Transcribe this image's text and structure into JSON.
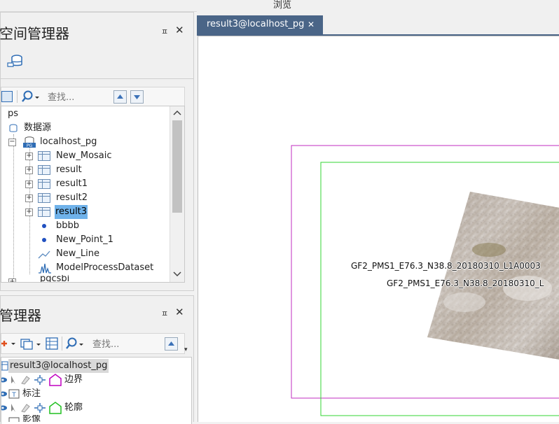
{
  "window": {
    "title": "浏览"
  },
  "workspace_panel": {
    "title": "空间管理器",
    "pin_glyph": "ㅍ",
    "close_glyph": "✕",
    "search_placeholder": "查找...",
    "tree": {
      "root": "ps",
      "datasources": "数据源",
      "connection": "localhost_pg",
      "datasets": [
        {
          "label": "New_Mosaic",
          "icon": "grid-dataset-icon"
        },
        {
          "label": "result",
          "icon": "grid-dataset-icon"
        },
        {
          "label": "result1",
          "icon": "grid-dataset-icon"
        },
        {
          "label": "result2",
          "icon": "grid-dataset-icon"
        },
        {
          "label": "result3",
          "icon": "grid-dataset-icon",
          "selected": true
        },
        {
          "label": "bbbb",
          "icon": "point-dataset-icon"
        },
        {
          "label": "New_Point_1",
          "icon": "point-dataset-icon"
        },
        {
          "label": "New_Line",
          "icon": "line-dataset-icon"
        },
        {
          "label": "ModelProcessDataset",
          "icon": "model-dataset-icon"
        }
      ],
      "partial_next": "pgcsbi"
    }
  },
  "layer_panel": {
    "title": "管理器",
    "pin_glyph": "ㅍ",
    "close_glyph": "✕",
    "search_placeholder": "查找...",
    "map_name": "result3@localhost_pg",
    "layers": [
      {
        "label": "边界",
        "color": "#c000c0"
      },
      {
        "label": "标注",
        "color": ""
      },
      {
        "label": "轮廓",
        "color": "#20c020"
      },
      {
        "label": "影像",
        "color": ""
      }
    ]
  },
  "map_tab": {
    "label": "result3@localhost_pg",
    "close_glyph": "✕"
  },
  "map": {
    "boundary_color": "#c02cc0",
    "outline_color": "#33d633",
    "labels": [
      "GF2_PMS1_E76.3_N38.8_20180310_L1A0003",
      "GF2_PMS1_E76.3_N38.8_20180310_L"
    ]
  },
  "colors": {
    "accent_tab": "#4a6587",
    "selection": "#6fb2ea"
  }
}
